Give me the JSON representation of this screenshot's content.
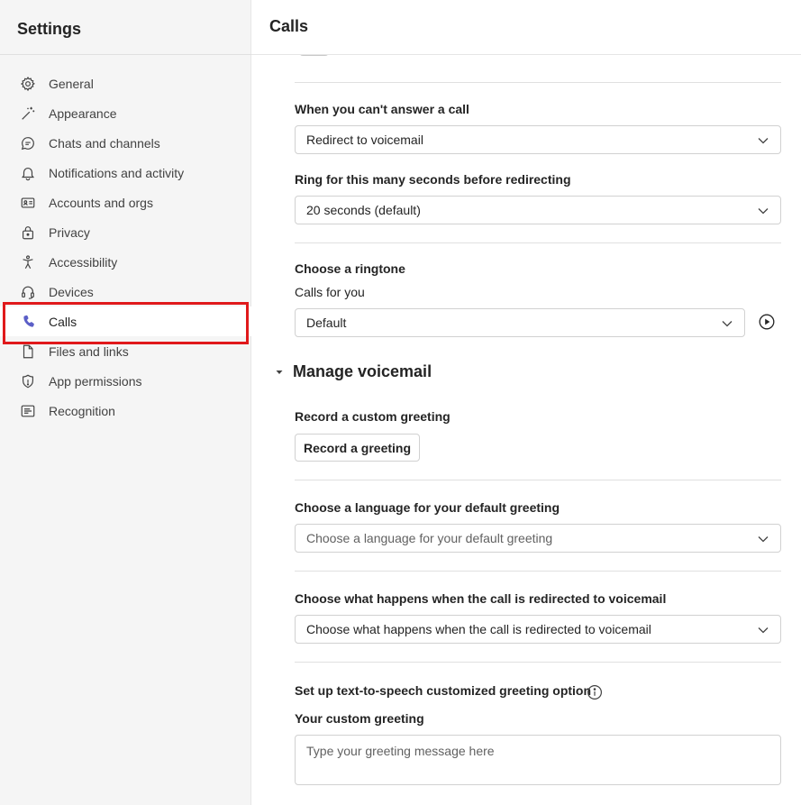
{
  "sidebar": {
    "title": "Settings",
    "items": [
      {
        "label": "General",
        "icon": "gear-icon"
      },
      {
        "label": "Appearance",
        "icon": "magic-wand-icon"
      },
      {
        "label": "Chats and channels",
        "icon": "chat-icon"
      },
      {
        "label": "Notifications and activity",
        "icon": "bell-icon"
      },
      {
        "label": "Accounts and orgs",
        "icon": "id-card-icon"
      },
      {
        "label": "Privacy",
        "icon": "lock-icon"
      },
      {
        "label": "Accessibility",
        "icon": "accessibility-icon"
      },
      {
        "label": "Devices",
        "icon": "headset-icon"
      },
      {
        "label": "Calls",
        "icon": "phone-icon",
        "selected": true
      },
      {
        "label": "Files and links",
        "icon": "document-icon"
      },
      {
        "label": "App permissions",
        "icon": "shield-icon"
      },
      {
        "label": "Recognition",
        "icon": "recognition-icon"
      }
    ]
  },
  "main": {
    "title": "Calls",
    "unanswered": {
      "label": "When you can't answer a call",
      "value": "Redirect to voicemail"
    },
    "ring_seconds": {
      "label": "Ring for this many seconds before redirecting",
      "value": "20 seconds (default)"
    },
    "ringtone": {
      "label": "Choose a ringtone",
      "sublabel": "Calls for you",
      "value": "Default"
    },
    "voicemail": {
      "section_title": "Manage voicemail",
      "greeting_label": "Record a custom greeting",
      "greeting_button": "Record a greeting",
      "language_label": "Choose a language for your default greeting",
      "language_placeholder": "Choose a language for your default greeting",
      "redirect_label": "Choose what happens when the call is redirected to voicemail",
      "redirect_value": "Choose what happens when the call is redirected to voicemail",
      "tts_label": "Set up text-to-speech customized greeting option",
      "custom_greeting_label": "Your custom greeting",
      "custom_greeting_placeholder": "Type your greeting message here"
    }
  },
  "colors": {
    "accent": "#5b5fc7",
    "highlight": "#e0191b"
  }
}
